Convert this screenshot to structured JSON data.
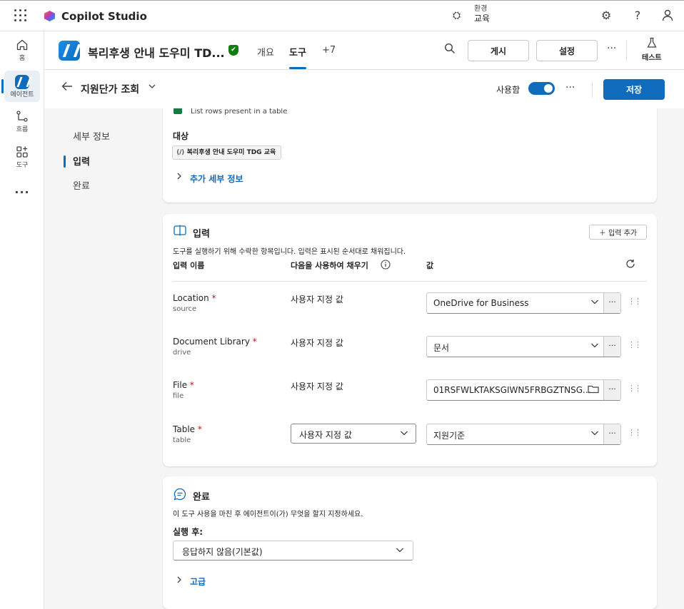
{
  "topbar": {
    "app_name": "Copilot Studio",
    "env_label": "환경",
    "env_name": "교육"
  },
  "rail": {
    "items": [
      {
        "label": "홈"
      },
      {
        "label": "에이전트"
      },
      {
        "label": "흐름"
      },
      {
        "label": "도구"
      }
    ]
  },
  "header": {
    "agent_title": "복리후생 안내 도우미 TD...",
    "tabs": [
      {
        "label": "개요"
      },
      {
        "label": "도구"
      },
      {
        "label": "+7"
      }
    ],
    "publish_label": "게시",
    "settings_label": "설정",
    "test_label": "테스트"
  },
  "subheader": {
    "title": "지원단가 조회",
    "enabled_label": "사용함",
    "enabled": true,
    "save_label": "저장"
  },
  "left_nav": {
    "items": [
      {
        "label": "세부 정보",
        "active": false
      },
      {
        "label": "입력",
        "active": true
      },
      {
        "label": "완료",
        "active": false
      }
    ]
  },
  "details_card": {
    "action_desc": "List rows present in a table",
    "target_label": "대상",
    "target_value": "복리후생 안내 도우미 TDG 교육",
    "more_details": "추가 세부 정보"
  },
  "inputs_card": {
    "title": "입력",
    "add_input": "입력 추가",
    "description": "도구를 실행하기 위해 수락한 항목입니다. 입력은 표시된 순서대로 채워집니다.",
    "col_name": "입력 이름",
    "col_fill": "다음을 사용하여 채우기",
    "col_value": "값",
    "rows": [
      {
        "name": "Location",
        "code": "source",
        "fill": "사용자 지정 값",
        "value": "OneDrive for Business"
      },
      {
        "name": "Document Library",
        "code": "drive",
        "fill": "사용자 지정 값",
        "value": "문서"
      },
      {
        "name": "File",
        "code": "file",
        "fill": "사용자 지정 값",
        "value": "01RSFWLKTAKSGIWN5FRBGZTNSG..."
      },
      {
        "name": "Table",
        "code": "table",
        "fill": "사용자 지정 값",
        "value": "지원기준"
      }
    ]
  },
  "completion_card": {
    "title": "완료",
    "description": "이 도구 사용을 마친 후 에이전트이(가) 무엇을 할지 지정하세요.",
    "after_label": "실행 후:",
    "after_value": "응답하지 않음(기본값)",
    "advanced": "고급"
  },
  "colors": {
    "accent": "#0f6cbd",
    "required": "#c50f1f",
    "verified": "#107c10"
  }
}
